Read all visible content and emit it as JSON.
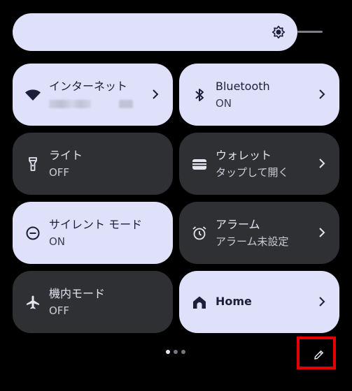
{
  "brightness": {
    "icon": "brightness-icon",
    "level": 0.88
  },
  "tiles": [
    {
      "title": "インターネット",
      "subtitle": "",
      "state": "on",
      "icon": "wifi-icon",
      "chevron": true
    },
    {
      "title": "Bluetooth",
      "subtitle": "ON",
      "state": "on",
      "icon": "bluetooth-icon",
      "chevron": true
    },
    {
      "title": "ライト",
      "subtitle": "OFF",
      "state": "off",
      "icon": "flashlight-icon",
      "chevron": false
    },
    {
      "title": "ウォレット",
      "subtitle": "タップして開く",
      "state": "off",
      "icon": "wallet-icon",
      "chevron": true
    },
    {
      "title": "サイレント モード",
      "subtitle": "ON",
      "state": "on",
      "icon": "do-not-disturb-icon",
      "chevron": false
    },
    {
      "title": "アラーム",
      "subtitle": "アラーム未設定",
      "state": "off",
      "icon": "alarm-icon",
      "chevron": true
    },
    {
      "title": "機内モード",
      "subtitle": "OFF",
      "state": "off",
      "icon": "airplane-icon",
      "chevron": false
    },
    {
      "title": "Home",
      "subtitle": "",
      "state": "on",
      "icon": "home-icon",
      "chevron": true
    }
  ],
  "pager": {
    "pages": 3,
    "current": 1
  },
  "edit": {
    "icon": "pencil-icon"
  },
  "colors": {
    "tile_on": "#dfe1fb",
    "tile_off": "#2f3034",
    "highlight": "#e40000"
  }
}
